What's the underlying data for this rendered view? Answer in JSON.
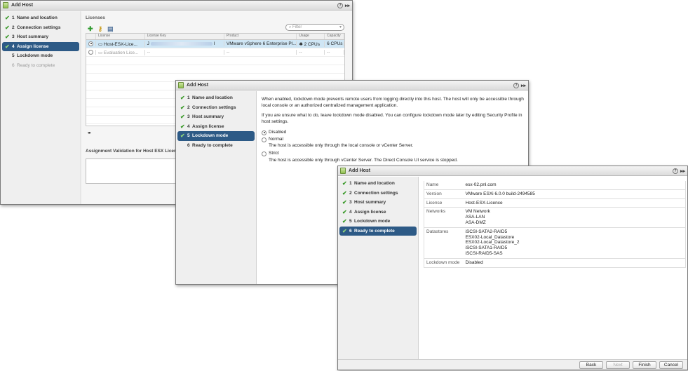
{
  "windows": [
    {
      "title": "Add Host",
      "steps": [
        {
          "num": "1",
          "label": "Name and location",
          "done": true
        },
        {
          "num": "2",
          "label": "Connection settings",
          "done": true
        },
        {
          "num": "3",
          "label": "Host summary",
          "done": true
        },
        {
          "num": "4",
          "label": "Assign license",
          "done": true,
          "active": true
        },
        {
          "num": "5",
          "label": "Lockdown mode",
          "done": false
        },
        {
          "num": "6",
          "label": "Ready to complete",
          "done": false,
          "dim": true
        }
      ]
    },
    {
      "title": "Add Host",
      "steps": [
        {
          "num": "1",
          "label": "Name and location",
          "done": true
        },
        {
          "num": "2",
          "label": "Connection settings",
          "done": true
        },
        {
          "num": "3",
          "label": "Host summary",
          "done": true
        },
        {
          "num": "4",
          "label": "Assign license",
          "done": true
        },
        {
          "num": "5",
          "label": "Lockdown mode",
          "done": true,
          "active": true
        },
        {
          "num": "6",
          "label": "Ready to complete",
          "done": false
        }
      ]
    },
    {
      "title": "Add Host",
      "steps": [
        {
          "num": "1",
          "label": "Name and location",
          "done": true
        },
        {
          "num": "2",
          "label": "Connection settings",
          "done": true
        },
        {
          "num": "3",
          "label": "Host summary",
          "done": true
        },
        {
          "num": "4",
          "label": "Assign license",
          "done": true
        },
        {
          "num": "5",
          "label": "Lockdown mode",
          "done": true
        },
        {
          "num": "6",
          "label": "Ready to complete",
          "done": true,
          "active": true
        }
      ]
    }
  ],
  "licenses": {
    "section_label": "Licenses",
    "filter_placeholder": "Filter",
    "columns": [
      "License",
      "License Key",
      "Product",
      "Usage",
      "Capacity"
    ],
    "rows": [
      {
        "license": "Host-ESX-Lice...",
        "key_prefix": "J",
        "key_suffix": "I",
        "product": "VMware vSphere 6 Enterprise Pl...",
        "usage": "2 CPUs",
        "capacity": "6 CPUs",
        "selected": true
      },
      {
        "license": "Evaluation Lice...",
        "key_prefix": "--",
        "key_suffix": "",
        "product": "--",
        "usage": "--",
        "capacity": "--",
        "selected": false
      }
    ],
    "assignment_label": "Assignment Validation for Host ESX Licence"
  },
  "lockdown": {
    "intro": "When enabled, lockdown mode prevents remote users from logging directly into this host. The host will only be accessible through local console or an authorized centralized management application.",
    "note": "If you are unsure what to do, leave lockdown mode disabled. You can configure lockdown mode later by editing Security Profile in host settings.",
    "options": [
      {
        "label": "Disabled",
        "desc": "",
        "selected": true
      },
      {
        "label": "Normal",
        "desc": "The host is accessible only through the local console or vCenter Server.",
        "selected": false
      },
      {
        "label": "Strict",
        "desc": "The host is accessible only through vCenter Server. The Direct Console UI service is stopped.",
        "selected": false
      }
    ]
  },
  "summary": {
    "rows": [
      {
        "key": "Name",
        "value": "esx-02.pnl.com"
      },
      {
        "key": "Version",
        "value": "VMware ESXi 6.0.0 build-2494585"
      },
      {
        "key": "License",
        "value": "Host-ESX-Licence"
      },
      {
        "key": "Networks",
        "value": "VM Network\nASA-LAN\nASA-DMZ"
      },
      {
        "key": "Datastores",
        "value": "iSCSI-SATA2-RAID5\nESX02-Local_Datastore\nESX02-Local_Datastore_2\niSCSI-SATA1-RAID5\niSCSI-RAID5-SAS"
      },
      {
        "key": "Lockdown mode",
        "value": "Disabled"
      }
    ]
  },
  "footer": {
    "back": "Back",
    "next": "Next",
    "finish": "Finish",
    "cancel": "Cancel"
  }
}
